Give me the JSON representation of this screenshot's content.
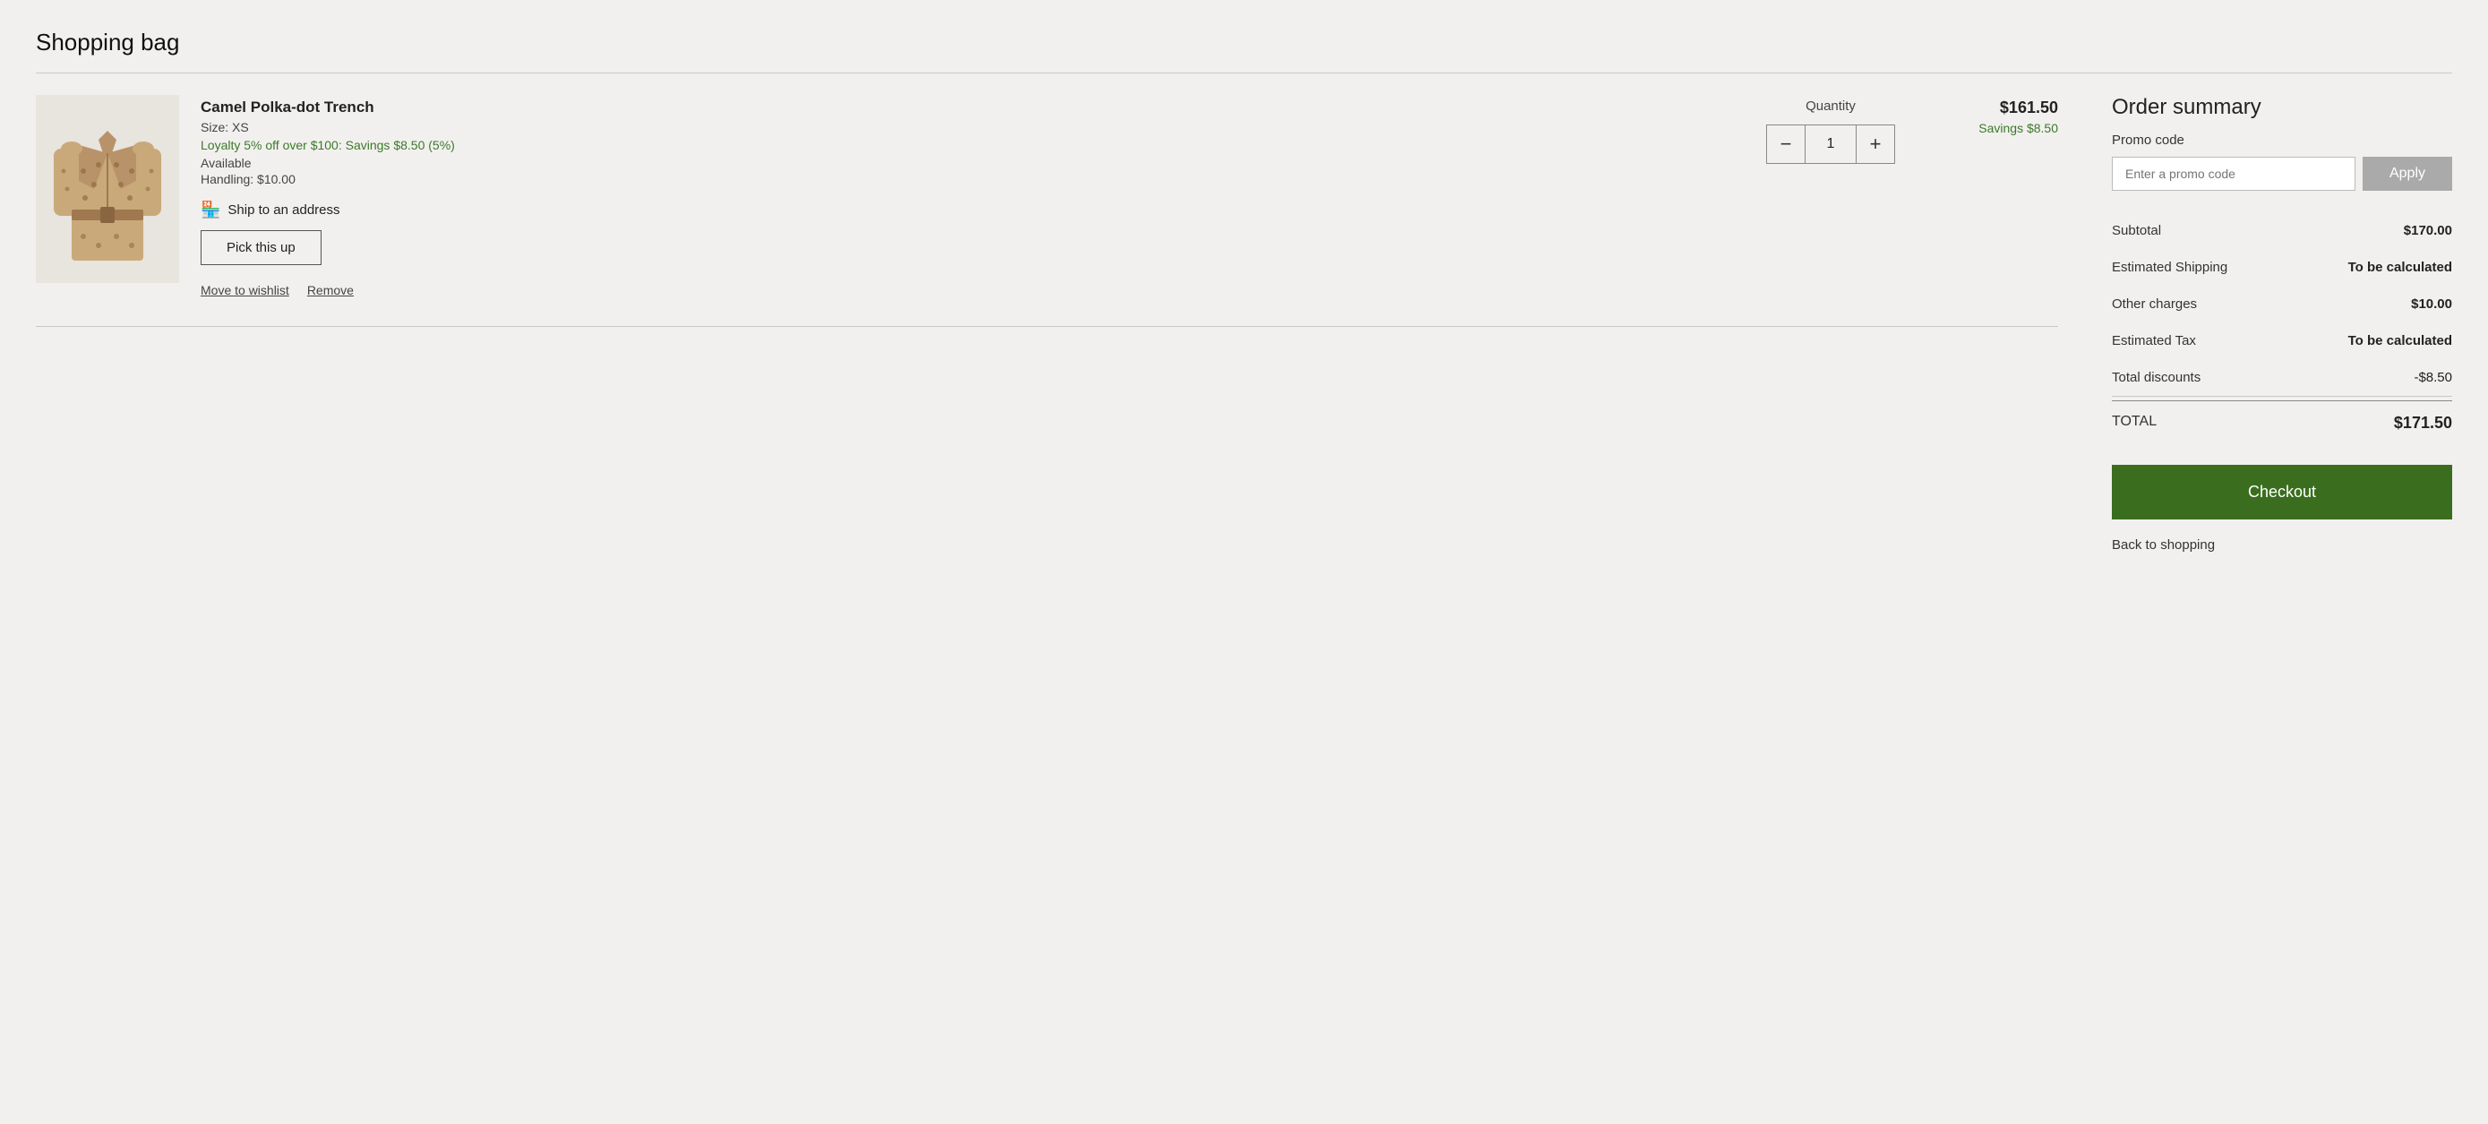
{
  "page": {
    "title": "Shopping bag"
  },
  "cart": {
    "item": {
      "name": "Camel Polka-dot Trench",
      "size_label": "Size: XS",
      "loyalty_text": "Loyalty 5% off over $100: Savings $8.50 (5%)",
      "available": "Available",
      "handling": "Handling: $10.00",
      "ship_label": "Ship to an address",
      "pickup_label": "Pick this up",
      "quantity_label": "Quantity",
      "quantity_value": "1",
      "price": "$161.50",
      "savings": "Savings $8.50",
      "move_wishlist": "Move to wishlist",
      "remove": "Remove",
      "minus_label": "−",
      "plus_label": "+"
    }
  },
  "order_summary": {
    "title": "Order summary",
    "promo_label": "Promo code",
    "promo_placeholder": "Enter a promo code",
    "apply_label": "Apply",
    "rows": [
      {
        "label": "Subtotal",
        "value": "$170.00",
        "bold": true,
        "border": false
      },
      {
        "label": "Estimated Shipping",
        "value": "To be calculated",
        "bold": true,
        "border": false
      },
      {
        "label": "Other charges",
        "value": "$10.00",
        "bold": true,
        "border": false
      },
      {
        "label": "Estimated Tax",
        "value": "To be calculated",
        "bold": true,
        "border": false
      },
      {
        "label": "Total discounts",
        "value": "-$8.50",
        "bold": false,
        "border": true
      }
    ],
    "total_label": "TOTAL",
    "total_value": "$171.50",
    "checkout_label": "Checkout",
    "back_label": "Back to shopping"
  }
}
